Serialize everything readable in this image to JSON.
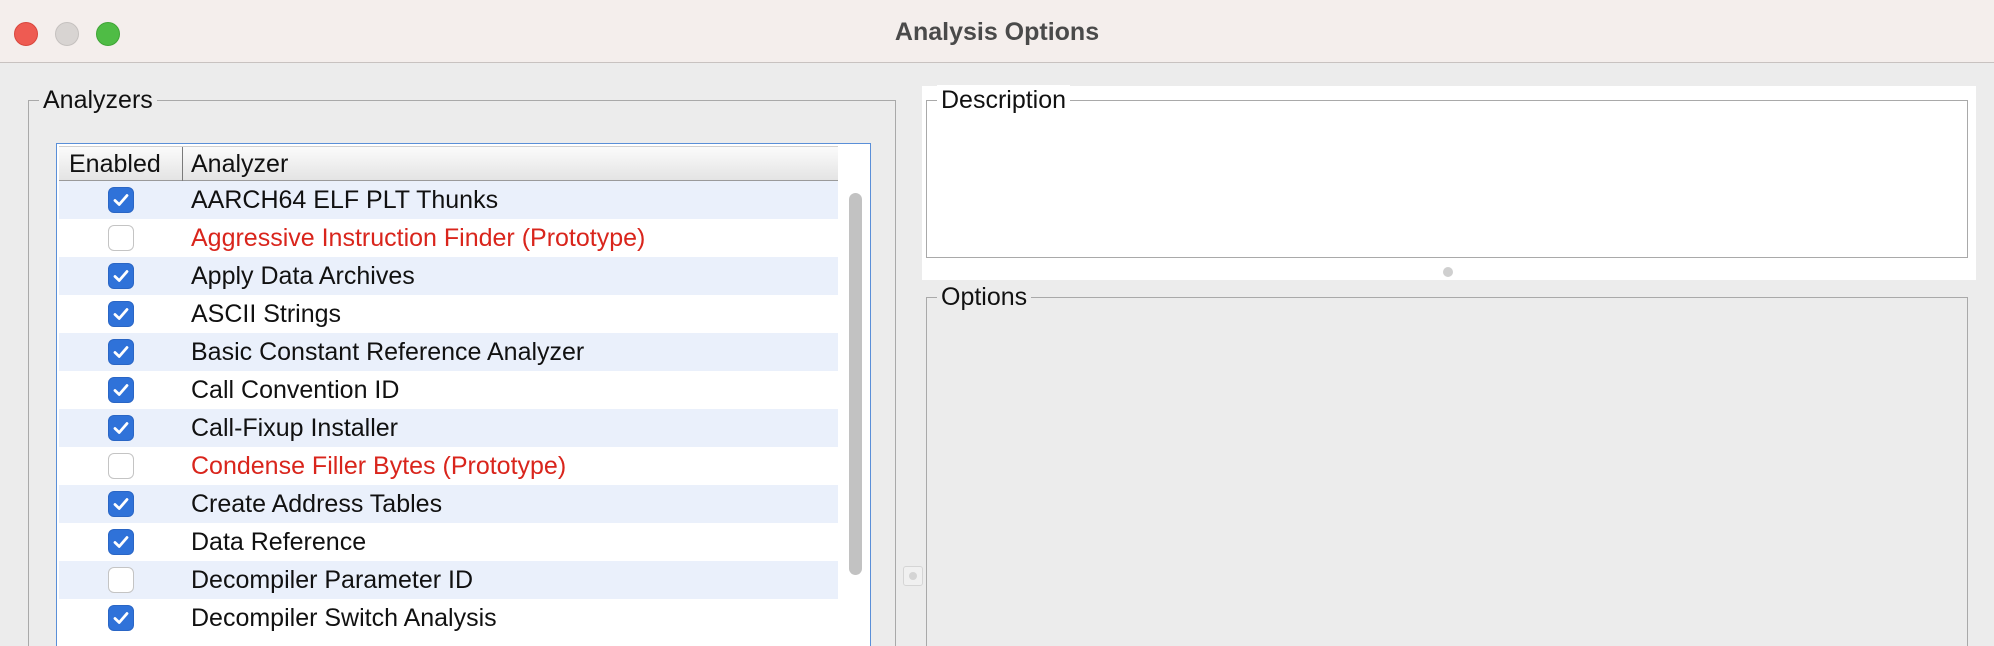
{
  "window": {
    "title": "Analysis Options"
  },
  "analyzers": {
    "group_label": "Analyzers",
    "columns": {
      "enabled": "Enabled",
      "analyzer": "Analyzer"
    },
    "rows": [
      {
        "name": "AARCH64 ELF PLT Thunks",
        "enabled": true,
        "prototype": false
      },
      {
        "name": "Aggressive Instruction Finder (Prototype)",
        "enabled": false,
        "prototype": true
      },
      {
        "name": "Apply Data Archives",
        "enabled": true,
        "prototype": false
      },
      {
        "name": "ASCII Strings",
        "enabled": true,
        "prototype": false
      },
      {
        "name": "Basic Constant Reference Analyzer",
        "enabled": true,
        "prototype": false
      },
      {
        "name": "Call Convention ID",
        "enabled": true,
        "prototype": false
      },
      {
        "name": "Call-Fixup Installer",
        "enabled": true,
        "prototype": false
      },
      {
        "name": "Condense Filler Bytes (Prototype)",
        "enabled": false,
        "prototype": true
      },
      {
        "name": "Create Address Tables",
        "enabled": true,
        "prototype": false
      },
      {
        "name": "Data Reference",
        "enabled": true,
        "prototype": false
      },
      {
        "name": "Decompiler Parameter ID",
        "enabled": false,
        "prototype": false
      },
      {
        "name": "Decompiler Switch Analysis",
        "enabled": true,
        "prototype": false
      }
    ]
  },
  "description": {
    "group_label": "Description"
  },
  "options": {
    "group_label": "Options"
  },
  "colors": {
    "checkbox_on": "#2f72d9",
    "prototype_text": "#d9251c",
    "row_alt": "#eaf0fb",
    "close_button": "#ee5b52",
    "zoom_button": "#4fbc45"
  }
}
